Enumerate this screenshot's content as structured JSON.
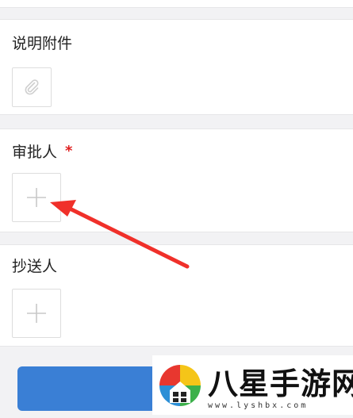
{
  "form": {
    "attachment": {
      "label": "说明附件",
      "icon": "paperclip-icon"
    },
    "approver": {
      "label": "审批人",
      "required_mark": "*",
      "icon": "plus-icon"
    },
    "cc": {
      "label": "抄送人",
      "icon": "plus-icon"
    }
  },
  "annotation": {
    "color": "#f0302a"
  },
  "watermark": {
    "brand": "八星手游网",
    "url": "www.lyshbx.com"
  },
  "colors": {
    "submit": "#3a7fd5",
    "required": "#e02020"
  }
}
